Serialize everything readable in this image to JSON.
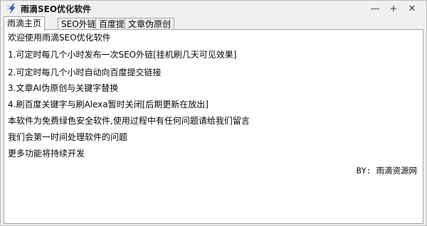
{
  "window": {
    "title": "雨滴SEO优化软件",
    "app_icon": "lightning-bolt-icon",
    "controls": {
      "minimize": "—",
      "maximize": "+",
      "close": "✕"
    }
  },
  "tabs": [
    {
      "label": "雨滴主页",
      "active": true
    },
    {
      "label": "SEO外链",
      "active": false
    },
    {
      "label": "百度提交",
      "active": false
    },
    {
      "label": "文章伪原创",
      "active": false
    }
  ],
  "content": {
    "lines": [
      "欢迎使用雨滴SEO优化软件",
      "1.可定时每几个小时发布一次SEO外链[挂机刷几天可见效果]",
      "2.可定时每几个小时自动向百度提交链接",
      "3.文章AI伪原创与关键字替换",
      "4.刷百度关键字与刷Alexa暂时关闭[后期更新在放出]",
      "本软件为免费绿色安全软件,使用过程中有任何问题请给我们留言",
      "我们会第一时间处理软件的问题",
      "更多功能将持续开发"
    ],
    "byline": "BY: 雨滴资源网"
  },
  "colors": {
    "window_bg": "#f0f0f0",
    "panel_bg": "#ffffff",
    "border": "#a0a0a0",
    "icon_blue": "#2b50c8"
  }
}
